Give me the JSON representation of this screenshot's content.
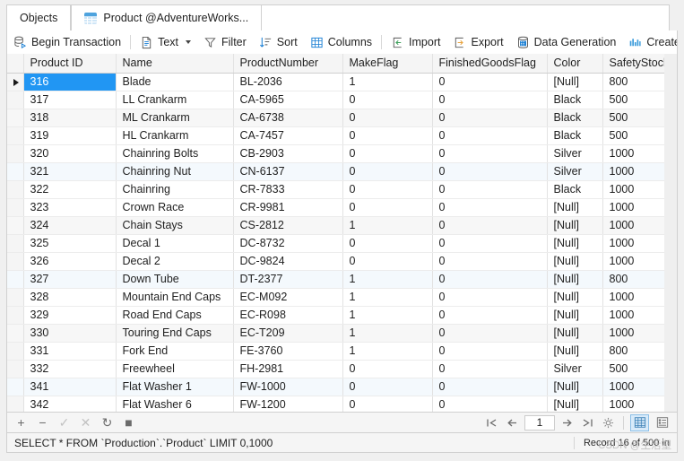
{
  "tabs": {
    "objects_label": "Objects",
    "active_tab_label": "Product @AdventureWorks...",
    "active_tab_icon": "table-icon"
  },
  "toolbar": {
    "begin_transaction": "Begin Transaction",
    "text": "Text",
    "filter": "Filter",
    "sort": "Sort",
    "columns": "Columns",
    "import": "Import",
    "export": "Export",
    "data_generation": "Data Generation",
    "create_chart": "Create Cha"
  },
  "grid": {
    "columns": [
      "Product ID",
      "Name",
      "ProductNumber",
      "MakeFlag",
      "FinishedGoodsFlag",
      "Color",
      "SafetyStock"
    ],
    "null_text": "[Null]",
    "selected_row_index": 0,
    "rows": [
      {
        "pid": "316",
        "name": "Blade",
        "pnum": "BL-2036",
        "make": "1",
        "fgf": "0",
        "color": "[Null]",
        "ss": "800"
      },
      {
        "pid": "317",
        "name": "LL Crankarm",
        "pnum": "CA-5965",
        "make": "0",
        "fgf": "0",
        "color": "Black",
        "ss": "500"
      },
      {
        "pid": "318",
        "name": "ML Crankarm",
        "pnum": "CA-6738",
        "make": "0",
        "fgf": "0",
        "color": "Black",
        "ss": "500"
      },
      {
        "pid": "319",
        "name": "HL Crankarm",
        "pnum": "CA-7457",
        "make": "0",
        "fgf": "0",
        "color": "Black",
        "ss": "500"
      },
      {
        "pid": "320",
        "name": "Chainring Bolts",
        "pnum": "CB-2903",
        "make": "0",
        "fgf": "0",
        "color": "Silver",
        "ss": "1000"
      },
      {
        "pid": "321",
        "name": "Chainring Nut",
        "pnum": "CN-6137",
        "make": "0",
        "fgf": "0",
        "color": "Silver",
        "ss": "1000"
      },
      {
        "pid": "322",
        "name": "Chainring",
        "pnum": "CR-7833",
        "make": "0",
        "fgf": "0",
        "color": "Black",
        "ss": "1000"
      },
      {
        "pid": "323",
        "name": "Crown Race",
        "pnum": "CR-9981",
        "make": "0",
        "fgf": "0",
        "color": "[Null]",
        "ss": "1000"
      },
      {
        "pid": "324",
        "name": "Chain Stays",
        "pnum": "CS-2812",
        "make": "1",
        "fgf": "0",
        "color": "[Null]",
        "ss": "1000"
      },
      {
        "pid": "325",
        "name": "Decal 1",
        "pnum": "DC-8732",
        "make": "0",
        "fgf": "0",
        "color": "[Null]",
        "ss": "1000"
      },
      {
        "pid": "326",
        "name": "Decal 2",
        "pnum": "DC-9824",
        "make": "0",
        "fgf": "0",
        "color": "[Null]",
        "ss": "1000"
      },
      {
        "pid": "327",
        "name": "Down Tube",
        "pnum": "DT-2377",
        "make": "1",
        "fgf": "0",
        "color": "[Null]",
        "ss": "800"
      },
      {
        "pid": "328",
        "name": "Mountain End Caps",
        "pnum": "EC-M092",
        "make": "1",
        "fgf": "0",
        "color": "[Null]",
        "ss": "1000"
      },
      {
        "pid": "329",
        "name": "Road End Caps",
        "pnum": "EC-R098",
        "make": "1",
        "fgf": "0",
        "color": "[Null]",
        "ss": "1000"
      },
      {
        "pid": "330",
        "name": "Touring End Caps",
        "pnum": "EC-T209",
        "make": "1",
        "fgf": "0",
        "color": "[Null]",
        "ss": "1000"
      },
      {
        "pid": "331",
        "name": "Fork End",
        "pnum": "FE-3760",
        "make": "1",
        "fgf": "0",
        "color": "[Null]",
        "ss": "800"
      },
      {
        "pid": "332",
        "name": "Freewheel",
        "pnum": "FH-2981",
        "make": "0",
        "fgf": "0",
        "color": "Silver",
        "ss": "500"
      },
      {
        "pid": "341",
        "name": "Flat Washer 1",
        "pnum": "FW-1000",
        "make": "0",
        "fgf": "0",
        "color": "[Null]",
        "ss": "1000"
      },
      {
        "pid": "342",
        "name": "Flat Washer 6",
        "pnum": "FW-1200",
        "make": "0",
        "fgf": "0",
        "color": "[Null]",
        "ss": "1000"
      }
    ]
  },
  "actionbar": {
    "add": "+",
    "remove": "−",
    "confirm": "✓",
    "cancel": "✕",
    "refresh": "↻",
    "stop": "■",
    "page_value": "1"
  },
  "status": {
    "sql": "SELECT * FROM `Production`.`Product` LIMIT 0,1000",
    "record_info": "Record 16 of 500 in",
    "watermark": "CSDN @生活塑"
  },
  "colors": {
    "accent": "#2196f3",
    "header_bg": "#f5f5f5",
    "selected_col_header": "#dce9f5",
    "hover_row": "#f4f9fd",
    "alt_row": "#f7f7f7",
    "null_text": "#b4b4b4",
    "toolbar_icon_blue": "#1a7fd4",
    "toolbar_icon_orange": "#e8a33d",
    "toolbar_icon_green": "#3da05a"
  }
}
